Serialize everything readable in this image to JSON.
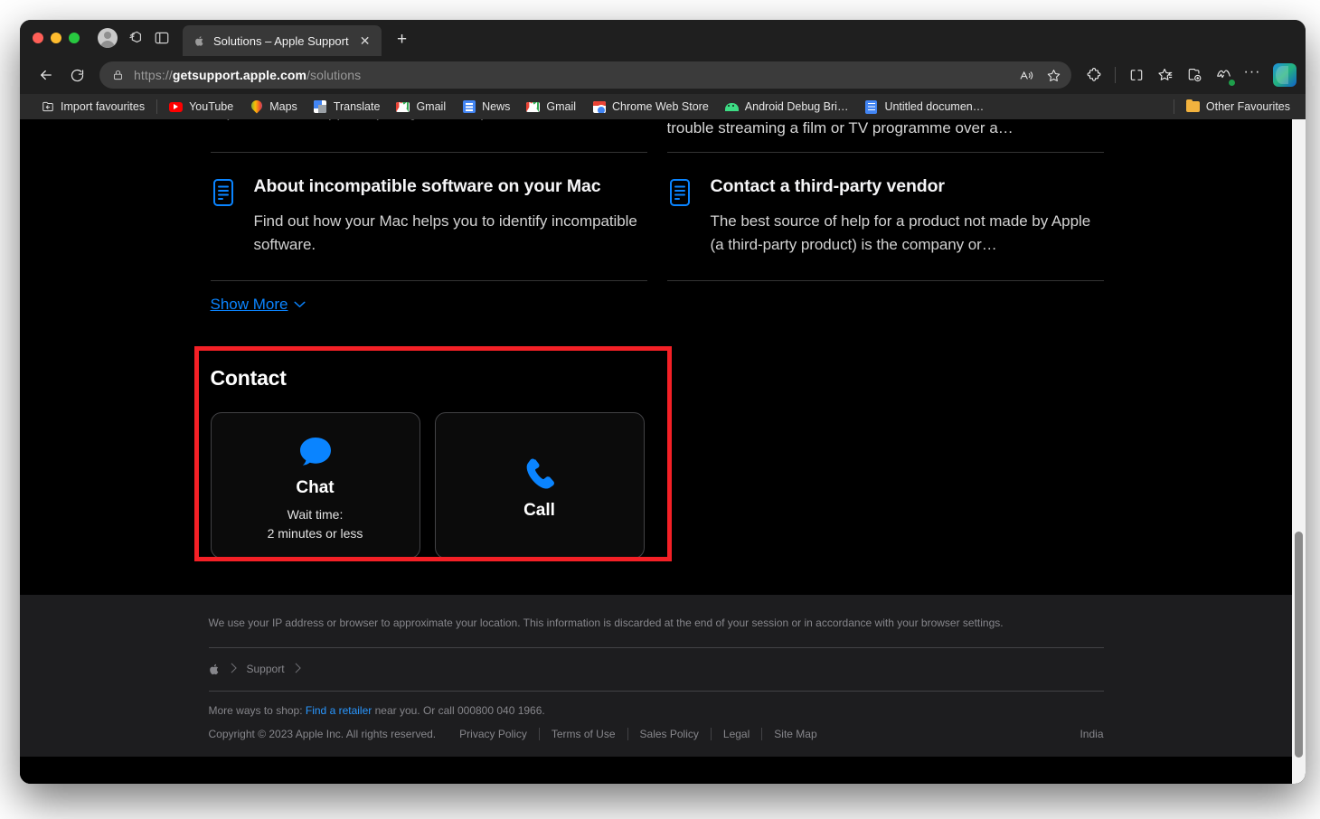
{
  "window": {
    "traffic_lights": [
      "close",
      "minimize",
      "maximize"
    ]
  },
  "tabstrip": {
    "profile_label": "profile-avatar",
    "tab_copilot_label": "tab-actions",
    "split_screen_label": "browser-sidebar",
    "tab": {
      "title": "Solutions – Apple Support",
      "favicon": "apple-icon",
      "close_label": "✕"
    },
    "new_tab_label": "+"
  },
  "navbar": {
    "back_label": "back-icon",
    "refresh_label": "refresh-icon",
    "url_prefix": "https://",
    "url_host": "getsupport.apple.com",
    "url_path": "/solutions",
    "read_aloud_label": "A",
    "favorite_label": "star-icon",
    "extensions_label": "puzzle-icon",
    "split_label": "split-screen-icon",
    "collections_label": "collections-icon",
    "add_to_collections_label": "add-to-collections-icon",
    "browser_essentials_label": "browser-essentials-icon",
    "settings_label": "···",
    "copilot_label": "copilot-icon"
  },
  "bookmarks": {
    "import_label": "Import favourites",
    "items": [
      {
        "label": "YouTube",
        "icon": "youtube-icon"
      },
      {
        "label": "Maps",
        "icon": "maps-icon"
      },
      {
        "label": "Translate",
        "icon": "translate-icon"
      },
      {
        "label": "Gmail",
        "icon": "gmail-icon"
      },
      {
        "label": "News",
        "icon": "google-news-icon"
      },
      {
        "label": "Gmail",
        "icon": "gmail-icon"
      },
      {
        "label": "Chrome Web Store",
        "icon": "chrome-web-store-icon"
      },
      {
        "label": "Android Debug Bri…",
        "icon": "android-icon"
      },
      {
        "label": "Untitled documen…",
        "icon": "google-docs-icon"
      }
    ],
    "other_favourites_label": "Other Favourites"
  },
  "page": {
    "clipped_top_right": "trouble streaming a film or TV programme over a…",
    "articles": [
      {
        "title": "About incompatible software on your Mac",
        "description": "Find out how your Mac helps you to identify incompatible software.",
        "icon": "document-icon"
      },
      {
        "title": "Contact a third-party vendor",
        "description": "The best source of help for a product not made by Apple (a third-party product) is the company or…",
        "icon": "document-icon"
      }
    ],
    "show_more_label": "Show More",
    "contact": {
      "heading": "Contact",
      "options": [
        {
          "label": "Chat",
          "icon": "chat-bubble-icon",
          "sub_line1": "Wait time:",
          "sub_line2": "2 minutes or less"
        },
        {
          "label": "Call",
          "icon": "phone-icon",
          "sub_line1": "",
          "sub_line2": ""
        }
      ]
    }
  },
  "footer": {
    "privacy_note": "We use your IP address or browser to approximate your location. This information is discarded at the end of your session or in accordance with your browser settings.",
    "breadcrumb": {
      "apple_logo": "",
      "support_label": "Support"
    },
    "shop_prefix": "More ways to shop: ",
    "shop_link": "Find a retailer",
    "shop_suffix": " near you. Or call 000800 040 1966.",
    "copyright": "Copyright © 2023 Apple Inc. All rights reserved.",
    "links": [
      "Privacy Policy",
      "Terms of Use",
      "Sales Policy",
      "Legal",
      "Site Map"
    ],
    "region": "India"
  },
  "colors": {
    "accent_blue": "#0a84ff",
    "link_blue": "#2997ff",
    "highlight_red": "#f42026",
    "page_bg": "#000000",
    "footer_bg": "#1d1d1f"
  },
  "scrollbar": {
    "thumb_top_pct": 62,
    "thumb_height_pct": 34
  }
}
